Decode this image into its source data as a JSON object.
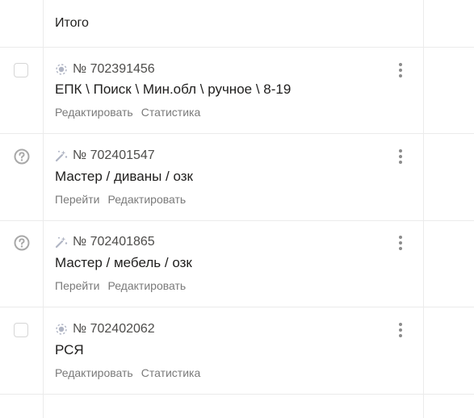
{
  "header": {
    "total_label": "Итого"
  },
  "campaigns": [
    {
      "number": "№ 702391456",
      "name": "ЕПК \\ Поиск \\ Мин.обл \\ ручное \\ 8-19",
      "status": "checkbox",
      "icon": "target-icon",
      "actions": [
        "Редактировать",
        "Статистика"
      ]
    },
    {
      "number": "№ 702401547",
      "name": "Мастер / диваны / озк",
      "status": "question",
      "icon": "magic-wand-icon",
      "actions": [
        "Перейти",
        "Редактировать"
      ]
    },
    {
      "number": "№ 702401865",
      "name": "Мастер / мебель / озк",
      "status": "question",
      "icon": "magic-wand-icon",
      "actions": [
        "Перейти",
        "Редактировать"
      ]
    },
    {
      "number": "№ 702402062",
      "name": "РСЯ",
      "status": "checkbox",
      "icon": "target-icon",
      "actions": [
        "Редактировать",
        "Статистика"
      ]
    }
  ],
  "colors": {
    "border": "#ebebeb",
    "muted": "#7a7a7a",
    "icon": "#b0b5c4"
  }
}
